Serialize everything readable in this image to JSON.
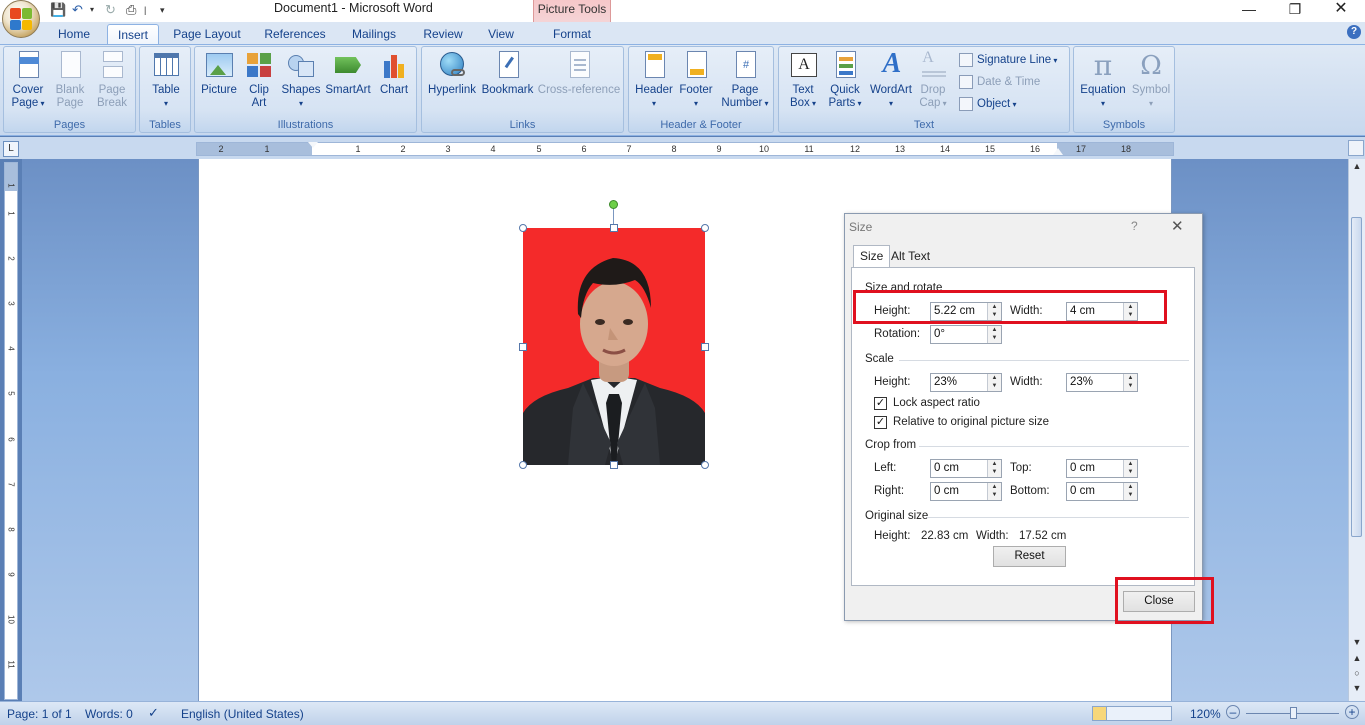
{
  "window": {
    "title": "Document1 - Microsoft Word",
    "context_tab_group": "Picture Tools",
    "controls": [
      "minimize",
      "restore",
      "close"
    ]
  },
  "quick_access": {
    "icons": [
      "save-icon",
      "undo-icon",
      "redo-icon",
      "print-icon",
      "customize-icon"
    ]
  },
  "tabs": [
    {
      "label": "Home",
      "active": false
    },
    {
      "label": "Insert",
      "active": true
    },
    {
      "label": "Page Layout",
      "active": false
    },
    {
      "label": "References",
      "active": false
    },
    {
      "label": "Mailings",
      "active": false
    },
    {
      "label": "Review",
      "active": false
    },
    {
      "label": "View",
      "active": false
    },
    {
      "label": "Format",
      "active": false
    }
  ],
  "ribbon": {
    "groups": {
      "pages": "Pages",
      "tables": "Tables",
      "illustrations": "Illustrations",
      "links": "Links",
      "header_footer": "Header & Footer",
      "text": "Text",
      "symbols": "Symbols"
    },
    "buttons": {
      "cover_page": [
        "Cover",
        "Page"
      ],
      "blank_page": [
        "Blank",
        "Page"
      ],
      "page_break": [
        "Page",
        "Break"
      ],
      "table": [
        "Table",
        ""
      ],
      "picture": [
        "Picture",
        ""
      ],
      "clip_art": [
        "Clip",
        "Art"
      ],
      "shapes": [
        "Shapes",
        ""
      ],
      "smartart": [
        "SmartArt",
        ""
      ],
      "chart": [
        "Chart",
        ""
      ],
      "hyperlink": [
        "Hyperlink",
        ""
      ],
      "bookmark": [
        "Bookmark",
        ""
      ],
      "cross_reference": [
        "Cross-reference",
        ""
      ],
      "header": [
        "Header",
        ""
      ],
      "footer": [
        "Footer",
        ""
      ],
      "page_number": [
        "Page",
        "Number"
      ],
      "text_box": [
        "Text",
        "Box"
      ],
      "quick_parts": [
        "Quick",
        "Parts"
      ],
      "wordart": [
        "WordArt",
        ""
      ],
      "drop_cap": [
        "Drop",
        "Cap"
      ],
      "equation": [
        "Equation",
        ""
      ],
      "symbol": [
        "Symbol",
        ""
      ]
    },
    "small": {
      "signature_line": "Signature Line",
      "date_time": "Date & Time",
      "object": "Object"
    }
  },
  "ruler": {
    "h_ticks": [
      "2",
      "1",
      "1",
      "2",
      "3",
      "4",
      "5",
      "6",
      "7",
      "8",
      "9",
      "10",
      "11",
      "12",
      "13",
      "14",
      "15",
      "16",
      "17",
      "18"
    ],
    "v_ticks": [
      "1",
      "1",
      "2",
      "3",
      "4",
      "5",
      "6",
      "7",
      "8",
      "9",
      "10",
      "11"
    ]
  },
  "dialog": {
    "title": "Size",
    "help": "?",
    "tabs": [
      "Size",
      "Alt Text"
    ],
    "size_rotate": {
      "heading": "Size and rotate",
      "height_label": "Height:",
      "height_value": "5.22 cm",
      "width_label": "Width:",
      "width_value": "4 cm",
      "rotation_label": "Rotation:",
      "rotation_value": "0°"
    },
    "scale": {
      "heading": "Scale",
      "height_label": "Height:",
      "height_value": "23%",
      "width_label": "Width:",
      "width_value": "23%",
      "lock_aspect": "Lock aspect ratio",
      "lock_aspect_checked": true,
      "relative_original": "Relative to original picture size",
      "relative_original_checked": true
    },
    "crop": {
      "heading": "Crop from",
      "left_label": "Left:",
      "left_value": "0 cm",
      "top_label": "Top:",
      "top_value": "0 cm",
      "right_label": "Right:",
      "right_value": "0 cm",
      "bottom_label": "Bottom:",
      "bottom_value": "0 cm"
    },
    "original": {
      "heading": "Original size",
      "height_label": "Height:",
      "height_value": "22.83 cm",
      "width_label": "Width:",
      "width_value": "17.52 cm",
      "reset": "Reset"
    },
    "close": "Close"
  },
  "status": {
    "page": "Page: 1 of 1",
    "words": "Words: 0",
    "language": "English (United States)",
    "zoom": "120%"
  },
  "colors": {
    "photo_background": "#f42a2a",
    "highlight": "#e0101f",
    "ribbon_text": "#15428b"
  }
}
